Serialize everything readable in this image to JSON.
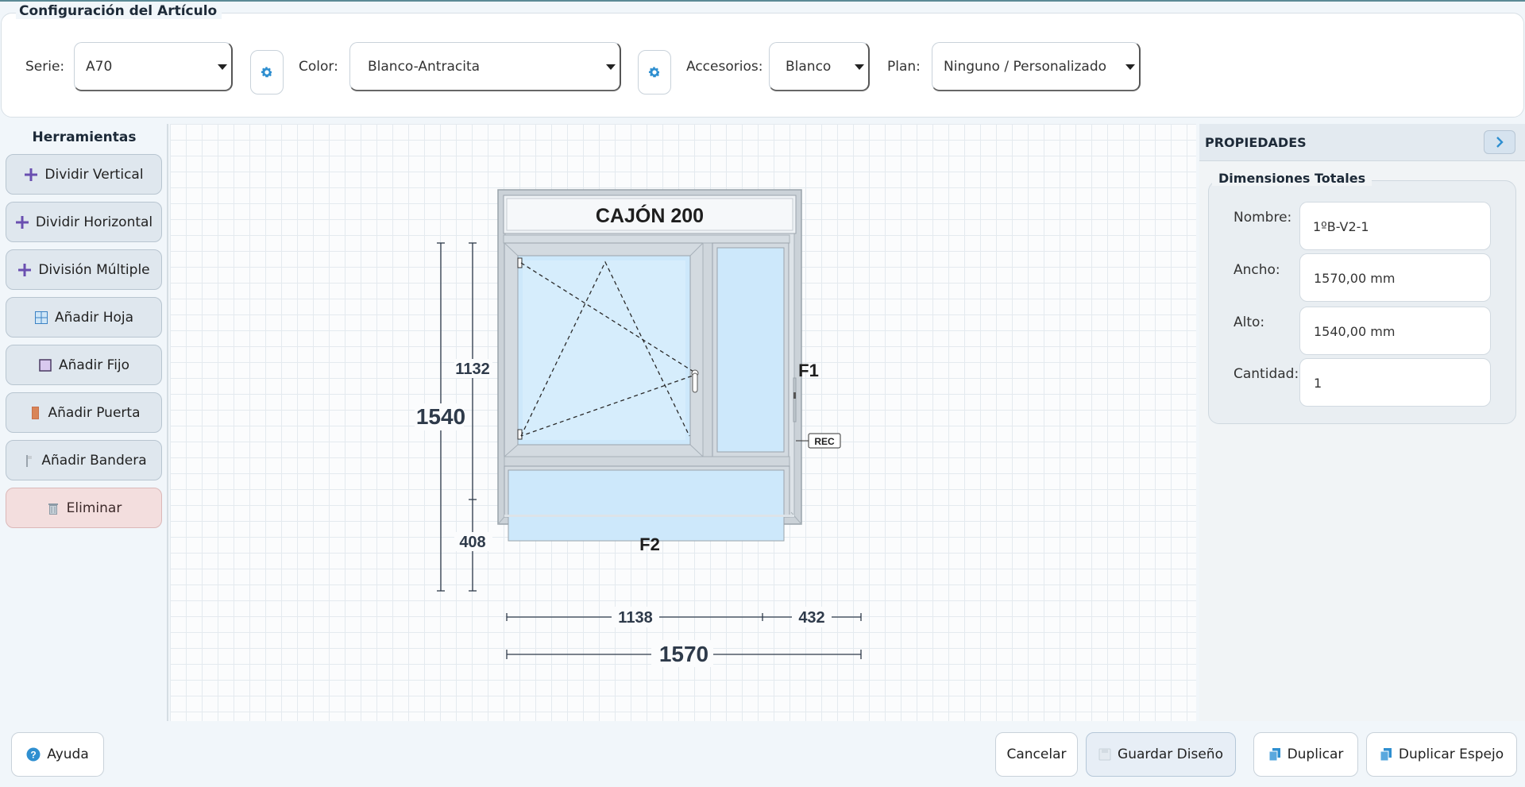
{
  "config": {
    "title": "Configuración del Artículo",
    "serie_label": "Serie:",
    "serie_value": "A70",
    "color_label": "Color:",
    "color_value": "Blanco-Antracita",
    "accesorios_label": "Accesorios:",
    "accesorios_value": "Blanco",
    "plan_label": "Plan:",
    "plan_value": "Ninguno / Personalizado"
  },
  "tools": {
    "title": "Herramientas",
    "items": [
      {
        "label": "Dividir Vertical",
        "icon": "plus-icon"
      },
      {
        "label": "Dividir Horizontal",
        "icon": "plus-icon"
      },
      {
        "label": "División Múltiple",
        "icon": "plus-icon"
      },
      {
        "label": "Añadir Hoja",
        "icon": "window-sash-icon"
      },
      {
        "label": "Añadir Fijo",
        "icon": "fixed-pane-icon"
      },
      {
        "label": "Añadir Puerta",
        "icon": "door-icon"
      },
      {
        "label": "Añadir Bandera",
        "icon": "flag-icon"
      },
      {
        "label": "Eliminar",
        "icon": "trash-icon"
      }
    ]
  },
  "drawing": {
    "cajon_label": "CAJÓN 200",
    "pane_f1": "F1",
    "pane_f2": "F2",
    "rec_label": "REC",
    "dim_total_height": "1540",
    "dim_upper_height": "1132",
    "dim_lower_height": "408",
    "dim_left_width": "1138",
    "dim_right_width": "432",
    "dim_total_width": "1570"
  },
  "properties": {
    "title": "PROPIEDADES",
    "group_title": "Dimensiones Totales",
    "nombre_label": "Nombre:",
    "nombre_value": "1ºB-V2-1",
    "ancho_label": "Ancho:",
    "ancho_value": "1570,00 mm",
    "alto_label": "Alto:",
    "alto_value": "1540,00 mm",
    "cantidad_label": "Cantidad:",
    "cantidad_value": "1"
  },
  "footer": {
    "help_label": "Ayuda",
    "cancel_label": "Cancelar",
    "save_label": "Guardar Diseño",
    "duplicate_label": "Duplicar",
    "mirror_label": "Duplicar Espejo"
  },
  "colors": {
    "accent": "#2f8fd0",
    "tool_plus": "#6a4fb0",
    "delete_bg": "#f3dede"
  }
}
